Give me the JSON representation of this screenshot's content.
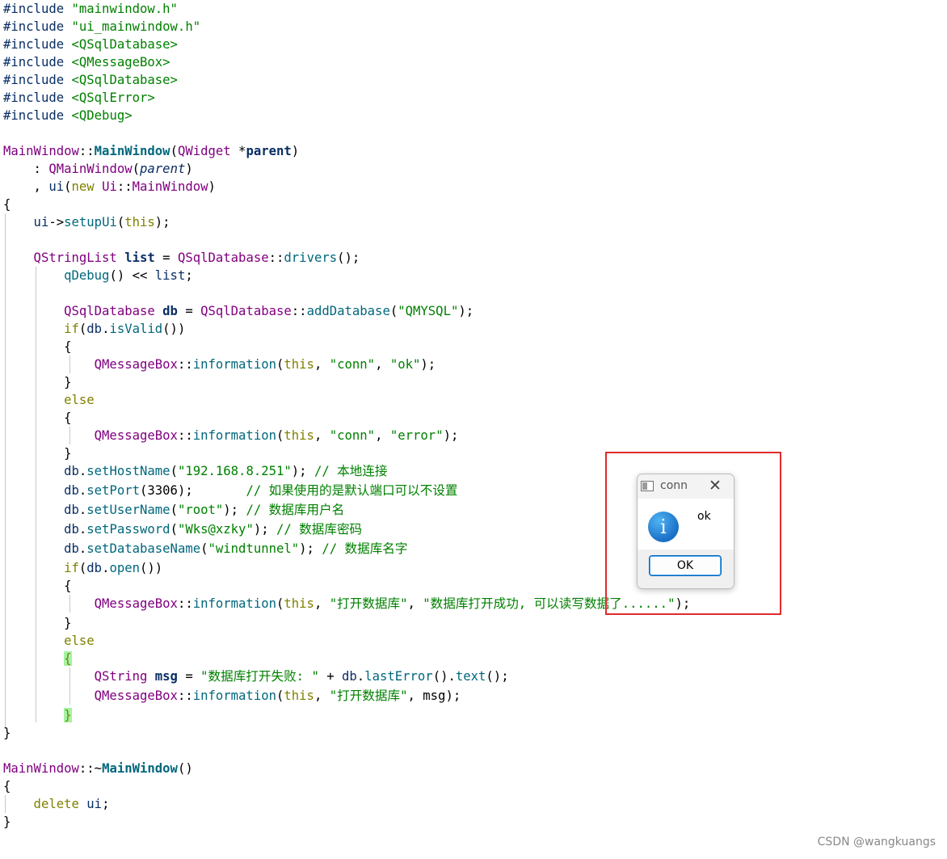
{
  "code": {
    "inc1_kw": "#include",
    "inc1_val": "\"mainwindow.h\"",
    "inc2_kw": "#include",
    "inc2_val": "\"ui_mainwindow.h\"",
    "inc3_kw": "#include",
    "inc3_val": "<QSqlDatabase>",
    "inc4_kw": "#include",
    "inc4_val": "<QMessageBox>",
    "inc5_kw": "#include",
    "inc5_val": "<QSqlDatabase>",
    "inc6_kw": "#include",
    "inc6_val": "<QSqlError>",
    "inc7_kw": "#include",
    "inc7_val": "<QDebug>",
    "ctor_class": "MainWindow",
    "ctor_sep": "::",
    "ctor_name": "MainWindow",
    "ctor_open": "(",
    "ctor_ptype": "QWidget",
    "ctor_star": " *",
    "ctor_pname": "parent",
    "ctor_close": ")",
    "init1_colon": "    : ",
    "init1_base": "QMainWindow",
    "init1_open": "(",
    "init1_arg": "parent",
    "init1_close": ")",
    "init2_comma": "    , ",
    "init2_ui": "ui",
    "init2_open": "(",
    "init2_new": "new",
    "init2_sp": " ",
    "init2_ns": "Ui",
    "init2_sep": "::",
    "init2_cls": "MainWindow",
    "init2_close": ")",
    "brace_open": "{",
    "setup_ui": "    ui",
    "setup_arrow": "->",
    "setup_fn": "setupUi",
    "setup_open": "(",
    "setup_this": "this",
    "setup_close": ");",
    "list_type": "    QStringList",
    "list_sp": " ",
    "list_var": "list",
    "list_eq": " = ",
    "list_cls": "QSqlDatabase",
    "list_sep": "::",
    "list_fn": "drivers",
    "list_close": "();",
    "qdebug_fn": "        qDebug",
    "qdebug_rest": "() << ",
    "qdebug_var": "list",
    "qdebug_end": ";",
    "db_type": "        QSqlDatabase",
    "db_sp": " ",
    "db_var": "db",
    "db_eq": " = ",
    "db_cls": "QSqlDatabase",
    "db_sep": "::",
    "db_fn": "addDatabase",
    "db_open": "(",
    "db_str": "\"QMYSQL\"",
    "db_close": ");",
    "if1_kw": "        if",
    "if1_open": "(",
    "if1_db": "db",
    "if1_dot": ".",
    "if1_fn": "isValid",
    "if1_close": "())",
    "b1_open": "        {",
    "mb1_cls": "            QMessageBox",
    "mb1_sep": "::",
    "mb1_fn": "information",
    "mb1_open": "(",
    "mb1_this": "this",
    "mb1_c1": ", ",
    "mb1_s1": "\"conn\"",
    "mb1_c2": ", ",
    "mb1_s2": "\"ok\"",
    "mb1_close": ");",
    "b1_close": "        }",
    "else1": "        else",
    "b2_open": "        {",
    "mb2_cls": "            QMessageBox",
    "mb2_sep": "::",
    "mb2_fn": "information",
    "mb2_open": "(",
    "mb2_this": "this",
    "mb2_c1": ", ",
    "mb2_s1": "\"conn\"",
    "mb2_c2": ", ",
    "mb2_s2": "\"error\"",
    "mb2_close": ");",
    "b2_close": "        }",
    "host_db": "        db",
    "host_dot": ".",
    "host_fn": "setHostName",
    "host_open": "(",
    "host_str": "\"192.168.8.251\"",
    "host_close": "); ",
    "host_cm": "// 本地连接",
    "port_db": "        db",
    "port_dot": ".",
    "port_fn": "setPort",
    "port_open": "(",
    "port_num": "3306",
    "port_close": ");       ",
    "port_cm": "// 如果使用的是默认端口可以不设置",
    "user_db": "        db",
    "user_dot": ".",
    "user_fn": "setUserName",
    "user_open": "(",
    "user_str": "\"root\"",
    "user_close": "); ",
    "user_cm": "// 数据库用户名",
    "pass_db": "        db",
    "pass_dot": ".",
    "pass_fn": "setPassword",
    "pass_open": "(",
    "pass_str": "\"Wks@xzky\"",
    "pass_close": "); ",
    "pass_cm": "// 数据库密码",
    "dbn_db": "        db",
    "dbn_dot": ".",
    "dbn_fn": "setDatabaseName",
    "dbn_open": "(",
    "dbn_str": "\"windtunnel\"",
    "dbn_close": "); ",
    "dbn_cm": "// 数据库名字",
    "if2_kw": "        if",
    "if2_open": "(",
    "if2_db": "db",
    "if2_dot": ".",
    "if2_fn": "open",
    "if2_close": "())",
    "b3_open": "        {",
    "mb3_cls": "            QMessageBox",
    "mb3_sep": "::",
    "mb3_fn": "information",
    "mb3_open": "(",
    "mb3_this": "this",
    "mb3_c1": ", ",
    "mb3_s1": "\"打开数据库\"",
    "mb3_c2": ", ",
    "mb3_s2": "\"数据库打开成功, 可以读写数据了......\"",
    "mb3_close": ");",
    "b3_close": "        }",
    "else2": "        else",
    "b4_indent": "        ",
    "b4_open": "{",
    "msg_type": "            QString",
    "msg_sp": " ",
    "msg_var": "msg",
    "msg_eq": " = ",
    "msg_str": "\"数据库打开失败: \"",
    "msg_plus": " + ",
    "msg_db": "db",
    "msg_dot": ".",
    "msg_fn1": "lastError",
    "msg_mid": "().",
    "msg_fn2": "text",
    "msg_close": "();",
    "mb4_cls": "            QMessageBox",
    "mb4_sep": "::",
    "mb4_fn": "information",
    "mb4_open": "(",
    "mb4_this": "this",
    "mb4_c1": ", ",
    "mb4_s1": "\"打开数据库\"",
    "mb4_c2": ", ",
    "mb4_var": "msg",
    "mb4_close": ");",
    "b4_indent2": "        ",
    "b4_close": "}",
    "brace_close": "}",
    "dtor_class": "MainWindow",
    "dtor_sep": "::~",
    "dtor_name": "MainWindow",
    "dtor_parens": "()",
    "dtor_open": "{",
    "dtor_del": "    delete",
    "dtor_sp": " ",
    "dtor_ui": "ui",
    "dtor_semi": ";",
    "dtor_close": "}"
  },
  "dialog": {
    "title": "conn",
    "message": "ok",
    "ok_label": "OK",
    "info_glyph": "i",
    "close_glyph": "✕"
  },
  "watermark": "CSDN @wangkuangs"
}
